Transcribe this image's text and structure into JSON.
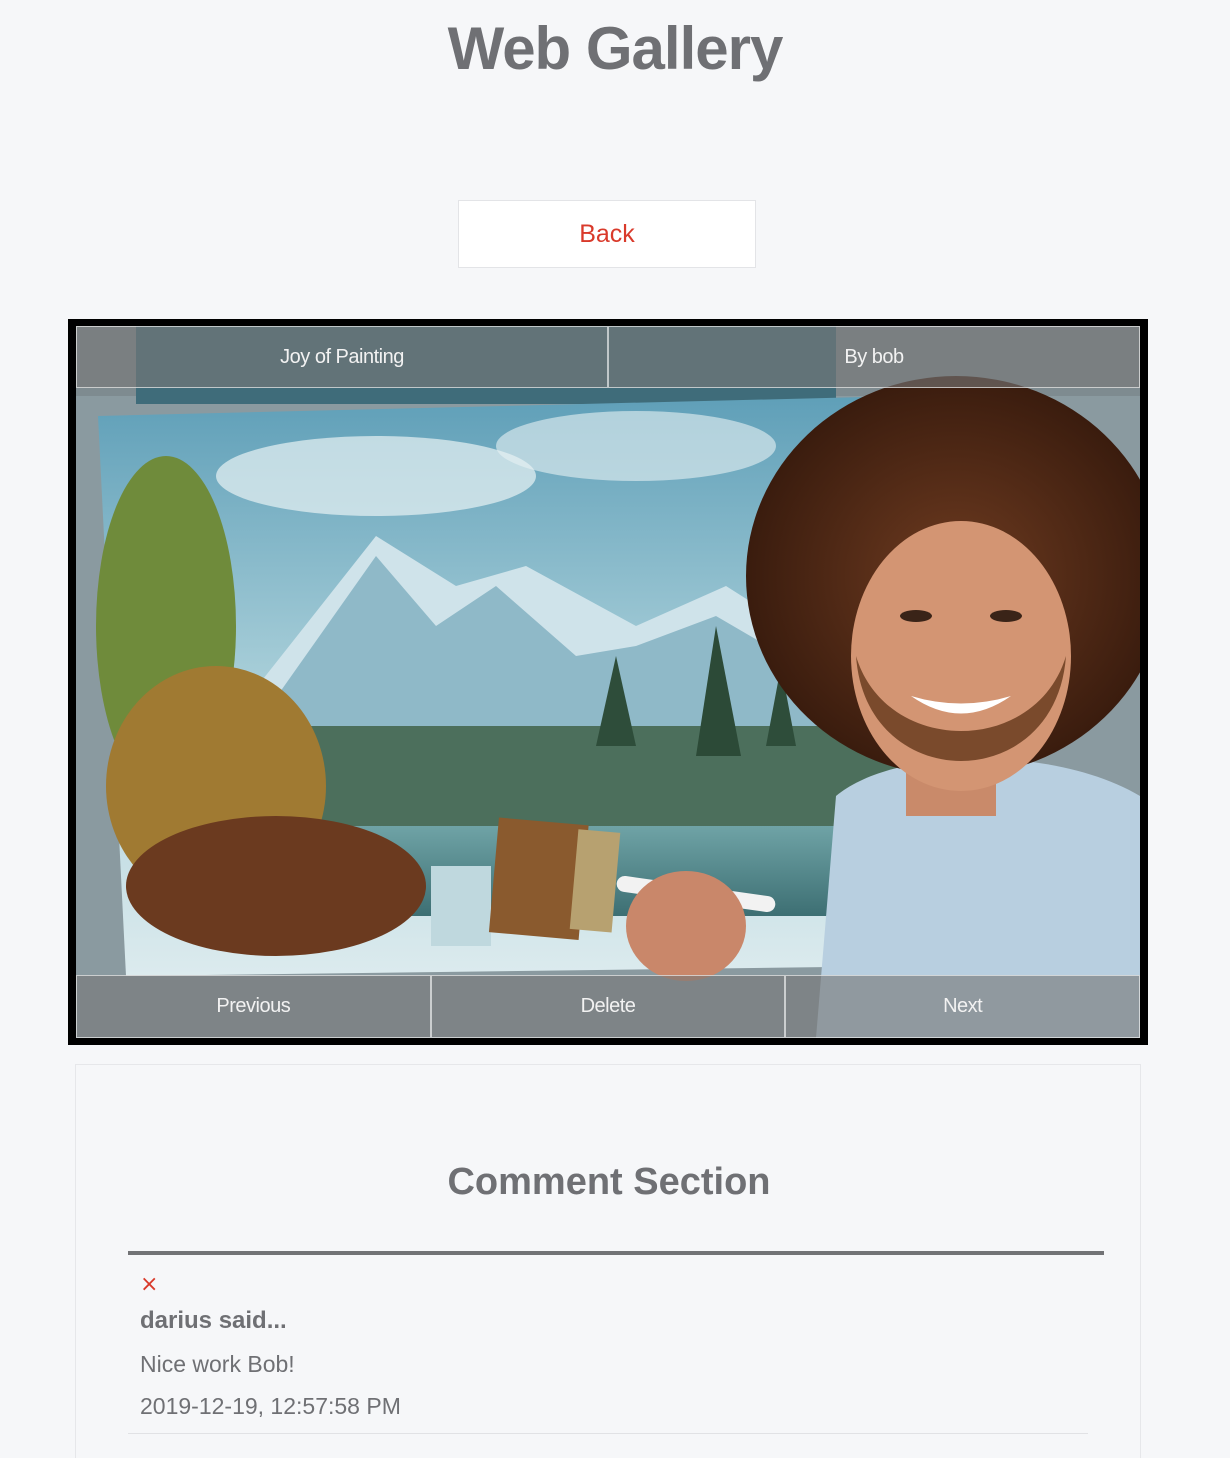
{
  "header": {
    "title": "Web Gallery"
  },
  "nav": {
    "back_label": "Back"
  },
  "image": {
    "title": "Joy of Painting",
    "author": "By bob",
    "controls": {
      "previous": "Previous",
      "delete": "Delete",
      "next": "Next"
    }
  },
  "comments": {
    "section_title": "Comment Section",
    "delete_icon": "×",
    "items": [
      {
        "author": "darius said...",
        "text": "Nice work Bob!",
        "timestamp": "2019-12-19, 12:57:58 PM"
      }
    ]
  },
  "colors": {
    "accent": "#d93a2b",
    "text": "#6f7074",
    "background": "#f6f7f9"
  }
}
